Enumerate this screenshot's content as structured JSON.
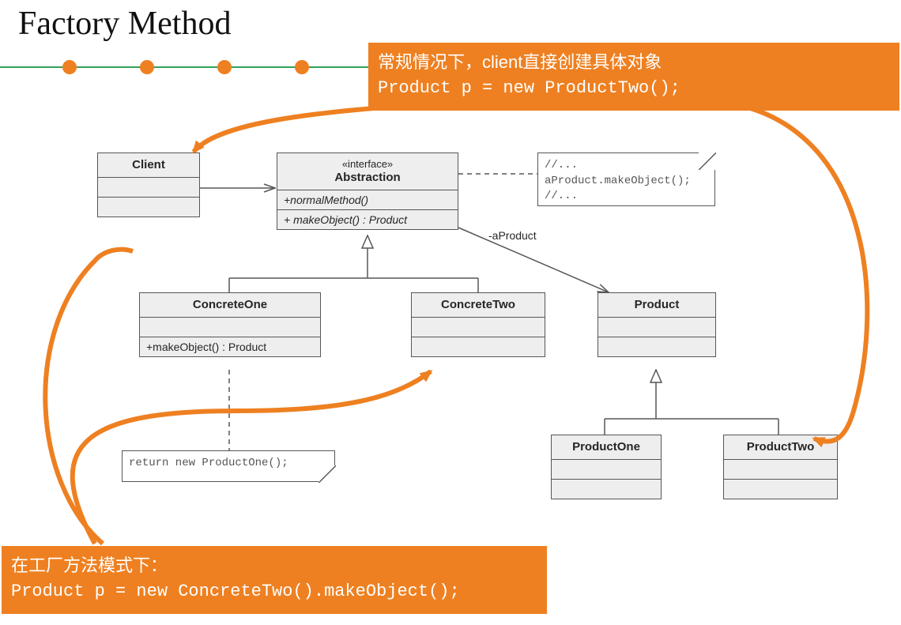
{
  "title": "Factory Method",
  "callout_top": {
    "line1": "常规情况下，client直接创建具体对象",
    "line2": "Product p = new ProductTwo();"
  },
  "callout_bottom": {
    "line1": "在工厂方法模式下：",
    "line2": "Product p = new ConcreteTwo().makeObject();"
  },
  "classes": {
    "client": {
      "name": "Client"
    },
    "abstraction": {
      "stereotype": "«interface»",
      "name": "Abstraction",
      "m1": "+normalMethod()",
      "m2": "+ makeObject() : Product"
    },
    "concreteOne": {
      "name": "ConcreteOne",
      "m1": "+makeObject() : Product"
    },
    "concreteTwo": {
      "name": "ConcreteTwo"
    },
    "product": {
      "name": "Product"
    },
    "productOne": {
      "name": "ProductOne"
    },
    "productTwo": {
      "name": "ProductTwo"
    }
  },
  "assoc": {
    "aProduct": "-aProduct"
  },
  "notes": {
    "makeObject": {
      "l1": "//...",
      "l2": "aProduct.makeObject();",
      "l3": "//..."
    },
    "returnNew": {
      "l1": "return new ProductOne();"
    }
  },
  "colors": {
    "orange": "#ee8021",
    "green": "#31a156",
    "gray": "#565656",
    "boxbg": "#eeeeee"
  }
}
